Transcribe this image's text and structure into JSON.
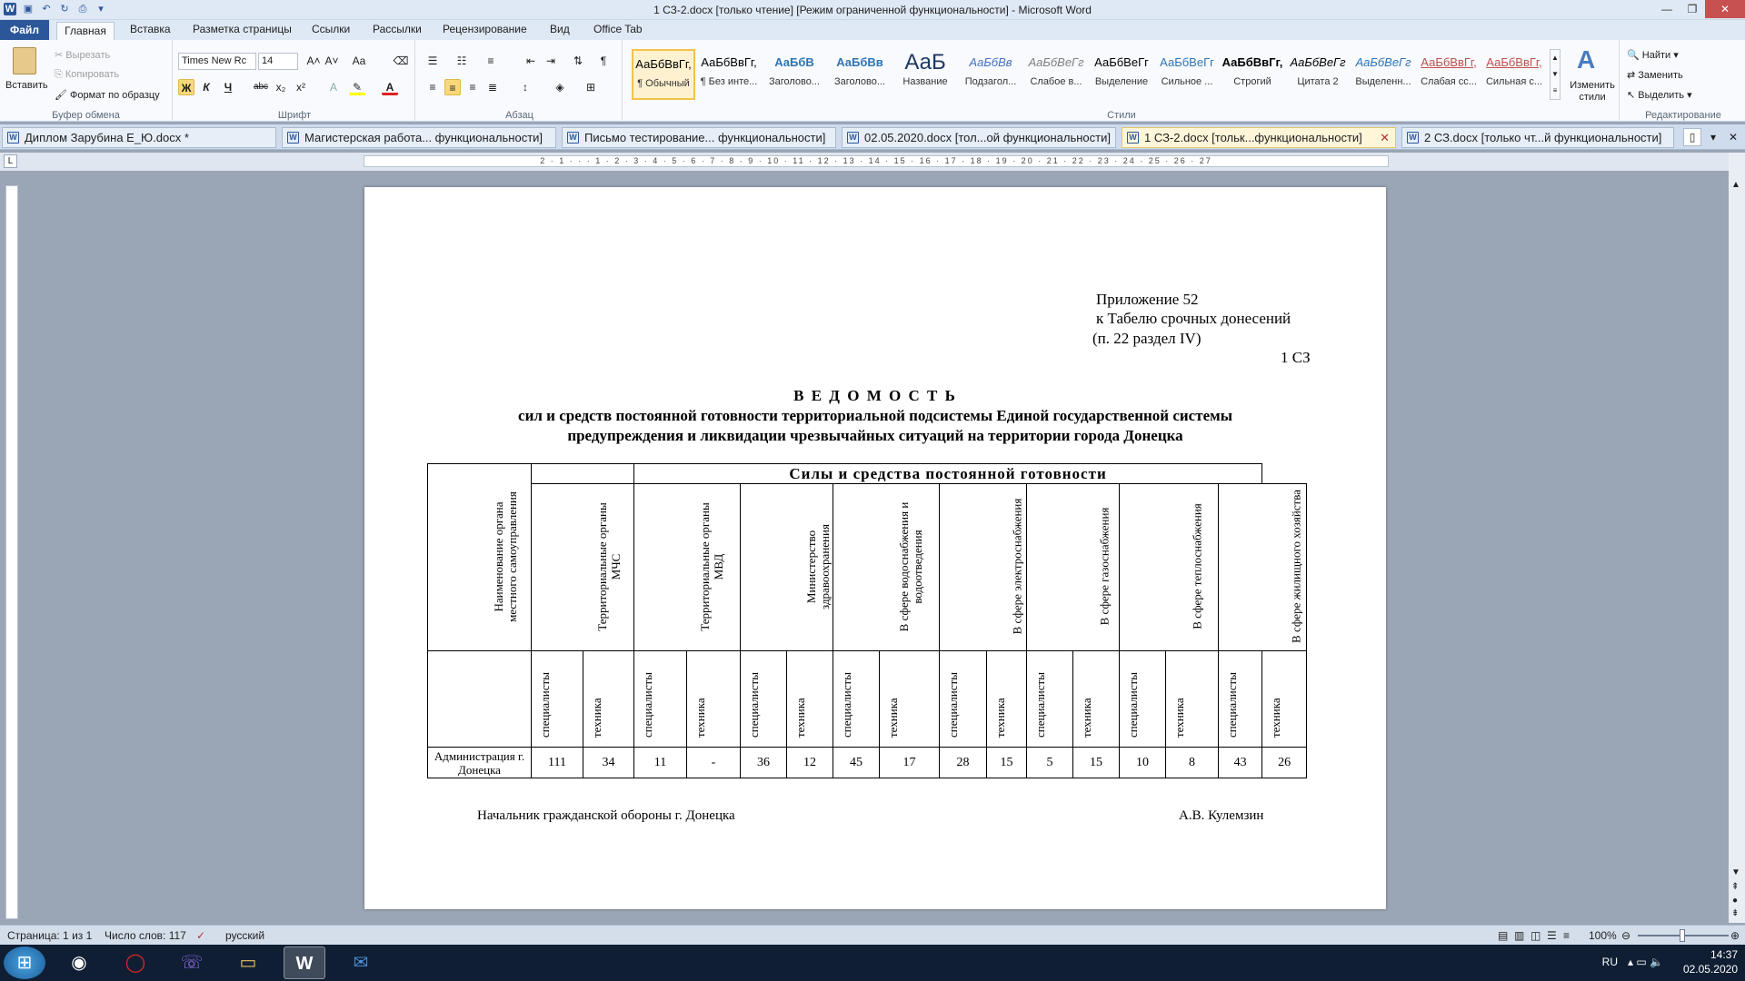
{
  "window": {
    "title": "1 СЗ-2.docx [только чтение] [Режим ограниченной функциональности]  -  Microsoft Word"
  },
  "ribbon_tabs": [
    "Файл",
    "Главная",
    "Вставка",
    "Разметка страницы",
    "Ссылки",
    "Рассылки",
    "Рецензирование",
    "Вид",
    "Office Tab"
  ],
  "clipboard": {
    "paste": "Вставить",
    "cut": "Вырезать",
    "copy": "Копировать",
    "format_painter": "Формат по образцу",
    "group": "Буфер обмена"
  },
  "font": {
    "name": "Times New Rc",
    "size": "14",
    "group": "Шрифт",
    "bold": "Ж",
    "italic": "К",
    "underline": "Ч",
    "strike": "abc",
    "subscript": "x₂",
    "superscript": "x²",
    "case": "Aa"
  },
  "paragraph": {
    "group": "Абзац"
  },
  "styles": {
    "group": "Стили",
    "items": [
      {
        "preview": "АаБбВвГг,",
        "name": "¶ Обычный",
        "color": "#000000"
      },
      {
        "preview": "АаБбВвГг,",
        "name": "¶ Без инте...",
        "color": "#000000"
      },
      {
        "preview": "АаБбВ",
        "name": "Заголово...",
        "color": "#2e74b5"
      },
      {
        "preview": "АаБбВв",
        "name": "Заголово...",
        "color": "#2e74b5"
      },
      {
        "preview": "АаБ",
        "name": "Название",
        "color": "#1f3864"
      },
      {
        "preview": "АаБбВв",
        "name": "Подзагол...",
        "color": "#4472c4"
      },
      {
        "preview": "АаБбВеГг",
        "name": "Слабое в...",
        "color": "#7f7f7f"
      },
      {
        "preview": "АаБбВеГг",
        "name": "Выделение",
        "color": "#000000"
      },
      {
        "preview": "АаБбВеГг",
        "name": "Сильное ...",
        "color": "#2e74b5"
      },
      {
        "preview": "АаБбВвГг,",
        "name": "Строгий",
        "color": "#000000"
      },
      {
        "preview": "АаБбВеГг",
        "name": "Цитата 2",
        "color": "#000000"
      },
      {
        "preview": "АаБбВеГг",
        "name": "Выделенн...",
        "color": "#2e74b5"
      },
      {
        "preview": "АаБбВвГг,",
        "name": "Слабая сс...",
        "color": "#c0504d"
      },
      {
        "preview": "АаБбВвГг,",
        "name": "Сильная с...",
        "color": "#c0504d"
      }
    ],
    "change": "Изменить стили"
  },
  "editing": {
    "find": "Найти",
    "replace": "Заменить",
    "select": "Выделить",
    "group": "Редактирование"
  },
  "doc_tabs": [
    "Диплом Зарубина Е_Ю.docx *",
    "Магистерская работа... функциональности]",
    "Письмо тестирование... функциональности]",
    "02.05.2020.docx [тол...ой функциональности]",
    "1 СЗ-2.docx [тольк...функциональности]",
    "2 СЗ.docx [только чт...й функциональности]"
  ],
  "ruler_text": "2 · 1 · · · 1 · 2 · 3 · 4 · 5 · 6 · 7 · 8 · 9 · 10 · 11 · 12 · 13 · 14 · 15 · 16 · 17 · 18 · 19 · 20 · 21 · 22 · 23 · 24 · 25 · 26 · 27",
  "document": {
    "appendix": [
      "Приложение 52",
      "к Табелю срочных донесений",
      "(п. 22 раздел IV)"
    ],
    "code": "1 СЗ",
    "title": "В Е Д О М О С Т Ь",
    "subtitle_1": "сил и средств постоянной готовности территориальной подсистемы Единой государственной системы",
    "subtitle_2": "предупреждения и ликвидации чрезвычайных ситуаций на территории города Донецка",
    "table": {
      "org_header": "Наименование органа местного самоуправления",
      "main_header": "Силы  и  средства  постоянной  готовности",
      "groups": [
        "Территориальные органы МЧС",
        "Территориальные органы МВД",
        "Министерство здравоохранения",
        "В сфере водоснабжения и водоотведения",
        "В сфере электроснабжения",
        "В сфере газоснабжения",
        "В сфере теплоснабжения",
        "В сфере жилищного хозяйства"
      ],
      "sub_specialists": "специалисты",
      "sub_tech": "техника",
      "row_label": "Администрация г. Донецка",
      "values": [
        "111",
        "34",
        "11",
        "-",
        "36",
        "12",
        "45",
        "17",
        "28",
        "15",
        "5",
        "15",
        "10",
        "8",
        "43",
        "26"
      ]
    },
    "signature_left": "Начальник  гражданской обороны  г. Донецка",
    "signature_right": "А.В. Кулемзин"
  },
  "status": {
    "page": "Страница: 1 из 1",
    "words": "Число слов: 117",
    "lang": "русский",
    "zoom": "100%"
  },
  "tray": {
    "lang": "RU",
    "time": "14:37",
    "date": "02.05.2020"
  }
}
